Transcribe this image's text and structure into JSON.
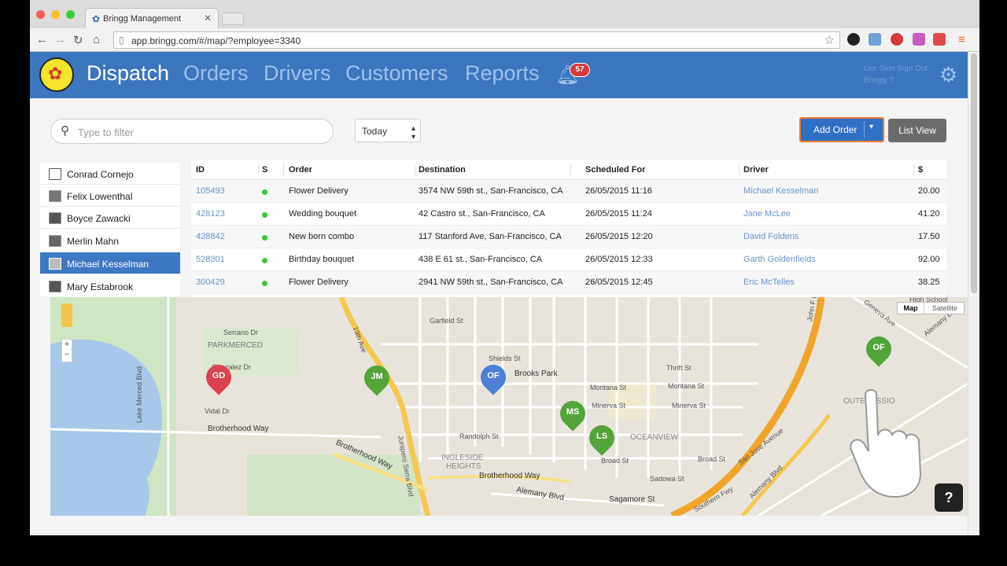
{
  "browser": {
    "tab_title": "Bringg Management",
    "url": "app.bringg.com/#/map/?employee=3340"
  },
  "header": {
    "nav": [
      "Dispatch",
      "Orders",
      "Drivers",
      "Customers",
      "Reports"
    ],
    "active_nav": "Dispatch",
    "notification_count": "57",
    "user_name": "Lior Sion",
    "sign_out": "Sign Out",
    "company": "Bringg",
    "company_suffix": "?"
  },
  "filter": {
    "placeholder": "Type to filter",
    "date_value": "Today"
  },
  "buttons": {
    "add_order": "Add Order",
    "list_view": "List View"
  },
  "employees": [
    {
      "name": "Conrad Cornejo",
      "selected": false
    },
    {
      "name": "Felix Lowenthal",
      "selected": false
    },
    {
      "name": "Boyce Zawacki",
      "selected": false
    },
    {
      "name": "Merlin Mahn",
      "selected": false
    },
    {
      "name": "Michael Kesselman",
      "selected": true
    },
    {
      "name": "Mary Estabrook",
      "selected": false
    }
  ],
  "orders": {
    "columns": [
      "ID",
      "S",
      "Order",
      "Destination",
      "Scheduled For",
      "Driver",
      "$"
    ],
    "rows": [
      {
        "id": "105493",
        "order": "Flower Delivery",
        "destination": "3574 NW 59th st., San-Francisco, CA",
        "scheduled": "26/05/2015 11:16",
        "driver": "Michael Kesselman",
        "amount": "20.00"
      },
      {
        "id": "428123",
        "order": "Wedding bouquet",
        "destination": "42 Castro  st., San-Francisco, CA",
        "scheduled": "26/05/2015 11:24",
        "driver": "Jane McLee",
        "amount": "41.20"
      },
      {
        "id": "428842",
        "order": "New born combo",
        "destination": "117 Stanford Ave, San-Francisco, CA",
        "scheduled": "26/05/2015 12:20",
        "driver": "David Foldens",
        "amount": "17.50"
      },
      {
        "id": "528301",
        "order": "Birthday bouquet",
        "destination": "438 E 61 st., San-Francisco, CA",
        "scheduled": "26/05/2015 12:33",
        "driver": "Garth Goldenfields",
        "amount": "92.00"
      },
      {
        "id": "300429",
        "order": "Flower Delivery",
        "destination": "2941 NW 59th st., San-Francisco, CA",
        "scheduled": "26/05/2015 12:45",
        "driver": "Eric McTelles",
        "amount": "38.25"
      }
    ]
  },
  "map": {
    "type_map": "Map",
    "type_satellite": "Satellite",
    "zoom_in": "+",
    "zoom_out": "−",
    "labels": {
      "parkmerced": "PARKMERCED",
      "ingleside": "INGLESIDE",
      "heights": "HEIGHTS",
      "oceanview": "OCEANVIEW",
      "outer_mission": "OUTE MISSIO",
      "brotherhood1": "Brotherhood Way",
      "brotherhood2": "Brotherhood Way",
      "brotherhood3": "Brotherhood Way",
      "lake_merced": "Lake Merced Blvd",
      "junipero": "Junipero Serra Blvd",
      "alemany": "Alemany Blvd",
      "alemany2": "Alemany Blvd",
      "alemany3": "Alemany Blvd",
      "sagamore": "Sagamore St",
      "brooks_park": "Brooks Park",
      "montana": "Montana St",
      "minerva": "Minerva St",
      "broad": "Broad St",
      "sadowa": "Sadowa St",
      "randolph": "Randolph St",
      "thrift": "Thrift St",
      "san_jose": "San Jose Avenue",
      "southern": "Southern Fwy",
      "vidal": "Vidal Dr",
      "gonzalez": "Gonzalez Dr",
      "serrano": "Serrano Dr",
      "high_school": "High School",
      "geneva": "Geneva Ave",
      "shields": "Shields St",
      "garfield": "Garfield St",
      "foran": "John F Foran Fwy",
      "nineteenth": "19th Ave"
    },
    "pins": [
      {
        "label": "GD",
        "color": "#d9434f"
      },
      {
        "label": "JM",
        "color": "#53a53a"
      },
      {
        "label": "OF",
        "color": "#4d7fd6"
      },
      {
        "label": "MS",
        "color": "#53a53a"
      },
      {
        "label": "LS",
        "color": "#53a53a"
      },
      {
        "label": "OF",
        "color": "#53a53a"
      }
    ]
  },
  "help": "?"
}
